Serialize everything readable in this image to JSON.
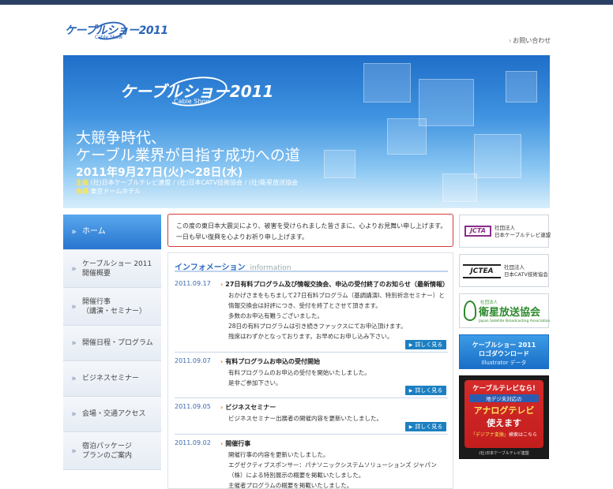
{
  "logo": {
    "text": "ケーブルショー2011",
    "sub": "Cable Show"
  },
  "header": {
    "contact": "お問い合わせ"
  },
  "hero": {
    "brand": "ケーブルショー2011",
    "brand_sub": "Cable Show",
    "line1": "大競争時代、",
    "line2": "ケーブル業界が目指す成功への道",
    "date": "2011年9月27日(火)〜28日(水)",
    "organizer_label": "主催",
    "organizer": "(社)日本ケーブルテレビ連盟 / (社)日本CATV技術協会 / (社)衛星放送協会",
    "venue_label": "会場",
    "venue": "東京ドームホテル"
  },
  "nav": [
    {
      "label": "ホーム"
    },
    {
      "label": "ケーブルショー 2011",
      "label2": "開催概要"
    },
    {
      "label": "開催行事",
      "label2": "（講演・セミナー）"
    },
    {
      "label": "開催日程・プログラム"
    },
    {
      "label": "ビジネスセミナー"
    },
    {
      "label": "会場・交通アクセス"
    },
    {
      "label": "宿泊パッケージ",
      "label2": "プランのご案内"
    }
  ],
  "notice": {
    "line1": "この度の東日本大震災により、被害を受けられました皆さまに、心よりお見舞い申し上げます。",
    "line2": "一日も早い復興を心よりお祈り申し上げます。"
  },
  "info": {
    "title": "インフォメーション",
    "title_en": "information",
    "more_label": "詳しく見る",
    "items": [
      {
        "date": "2011.09.17",
        "title": "27日有料プログラム及び情報交換会、申込の受付終了のお知らせ（最新情報）",
        "lines": [
          "おかげさまをもちまして27日有料プログラム（基調講演Ⅰ、特別祈念セミナー）と",
          "情報交換会は好評につき、受付を終了とさせて頂きます。",
          "多数のお申込有難うございました。",
          "28日の有料プログラムは引き続きファックスにてお申込頂けます。",
          "残席はわずかとなっております。お早めにお申し込み下さい。"
        ]
      },
      {
        "date": "2011.09.07",
        "title": "有料プログラムお申込の受付開始",
        "lines": [
          "有料プログラムのお申込の受付を開始いたしました。",
          "是非ご参加下さい。"
        ]
      },
      {
        "date": "2011.09.05",
        "title": "ビジネスセミナー",
        "lines": [
          "ビジネスセミナー出展者の開催内容を更新いたしました。"
        ]
      },
      {
        "date": "2011.09.02",
        "title": "開催行事",
        "lines": [
          "開催行事の内容を更新いたしました。",
          "エグゼクティブスポンサー：パナソニックシステムソリューションズ ジャパン",
          "（株）による特別展示の概要を掲載いたしました。",
          "主催者プログラムの概要を掲載いたしました。"
        ]
      }
    ]
  },
  "banners": {
    "jcta": {
      "logo": "JCTA",
      "line1": "社団法人",
      "line2": "日本ケーブルテレビ連盟"
    },
    "jctea": {
      "logo": "JCTEA",
      "line1": "社団法人",
      "line2": "日本CATV技術協会"
    },
    "sat": {
      "small": "社団法人",
      "big": "衛星放送協会",
      "en": "Japan Satellite Broadcasting Association"
    },
    "download": {
      "line1": "ケーブルショー 2011",
      "line2": "ロゴダウンロード",
      "line3": "Illustrator データ"
    },
    "tv": {
      "line1": "ケーブルテレビなら!",
      "line2": "地デジ未対応の",
      "line3": "アナログテレビ",
      "line4": "使えます",
      "line5_a": "「デジアナ変換」",
      "line5_b": "検索はこちら",
      "line6": "(社)日本ケーブルテレビ連盟"
    }
  }
}
